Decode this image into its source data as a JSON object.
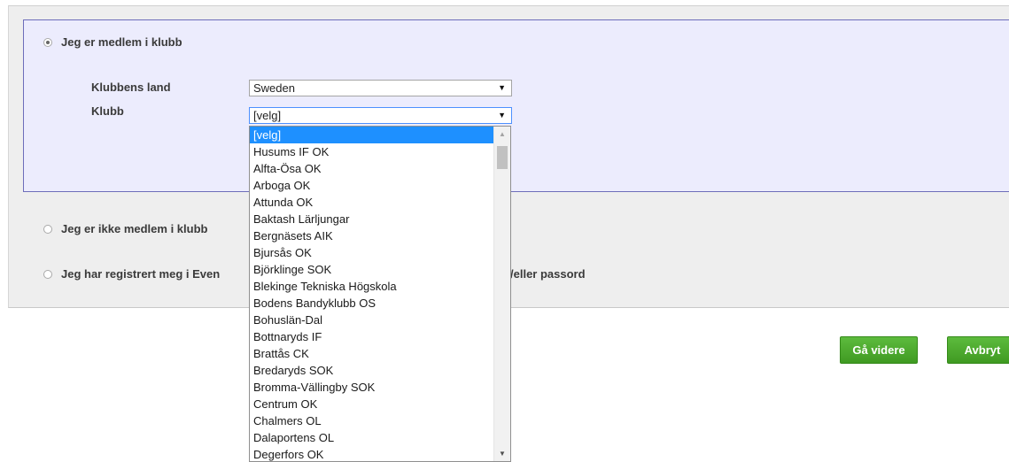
{
  "membership": {
    "option_member": "Jeg er medlem i klubb",
    "option_not_member": "Jeg er ikke medlem i klubb",
    "option_registered": "Jeg har registrert meg i Even",
    "option_registered_tail": "/eller passord",
    "selected_option": "member"
  },
  "form": {
    "country_label": "Klubbens land",
    "country_value": "Sweden",
    "club_label": "Klubb",
    "club_value": "[velg]"
  },
  "club_dropdown": {
    "selected_index": 0,
    "options": [
      "[velg]",
      "Husums IF OK",
      "Alfta-Ösa OK",
      "Arboga OK",
      "Attunda OK",
      "Baktash Lärljungar",
      "Bergnäsets AIK",
      "Bjursås OK",
      "Björklinge SOK",
      "Blekinge Tekniska Högskola",
      "Bodens Bandyklubb OS",
      "Bohuslän-Dal",
      "Bottnaryds IF",
      "Brattås CK",
      "Bredaryds SOK",
      "Bromma-Vällingby SOK",
      "Centrum OK",
      "Chalmers OL",
      "Dalaportens OL",
      "Degerfors OK"
    ]
  },
  "buttons": {
    "continue_label": "Gå videre",
    "cancel_label": "Avbryt"
  },
  "icons": {
    "dropdown_arrow": "▼",
    "scroll_up": "▲",
    "scroll_down": "▼"
  },
  "colors": {
    "accent_button": "#4aa82b",
    "selected_option_bg": "#1e90ff",
    "member_box_border": "#6d6dba"
  }
}
